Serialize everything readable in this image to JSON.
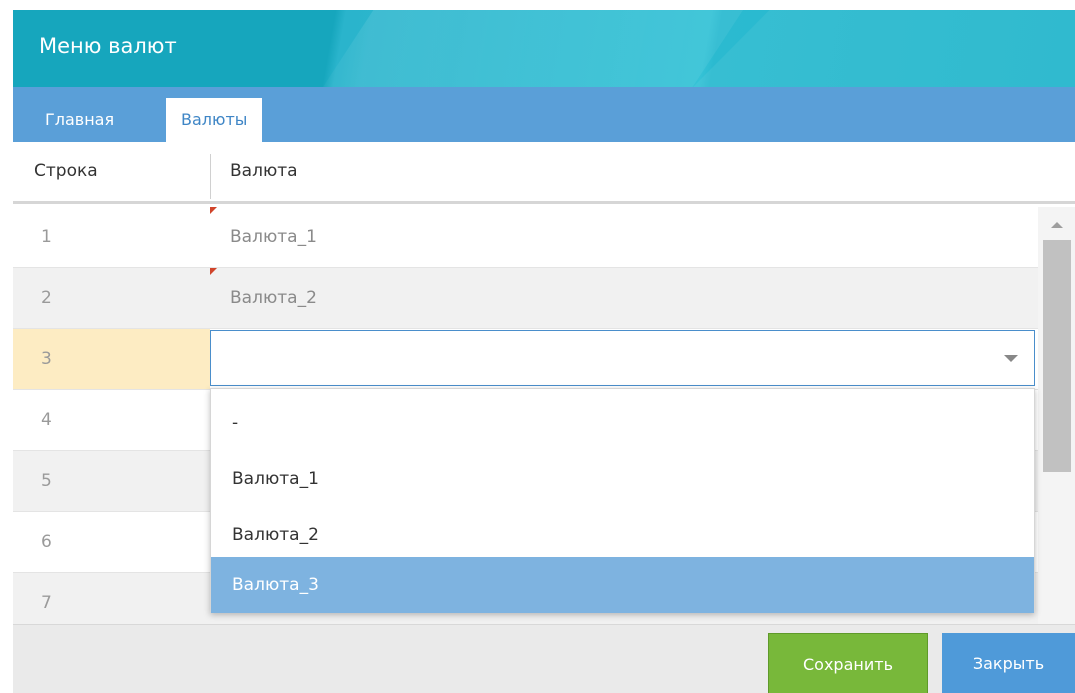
{
  "window": {
    "title": "Меню валют"
  },
  "tabs": [
    {
      "label": "Главная",
      "active": false
    },
    {
      "label": "Валюты",
      "active": true
    }
  ],
  "table": {
    "columns": [
      "Строка",
      "Валюта"
    ],
    "rows": [
      {
        "num": "1",
        "value": "Валюта_1",
        "flag": true
      },
      {
        "num": "2",
        "value": "Валюта_2",
        "flag": true
      },
      {
        "num": "3",
        "value": "",
        "editing": true
      },
      {
        "num": "4",
        "value": ""
      },
      {
        "num": "5",
        "value": ""
      },
      {
        "num": "6",
        "value": ""
      },
      {
        "num": "7",
        "value": ""
      }
    ]
  },
  "dropdown": {
    "options": [
      "-",
      "Валюта_1",
      "Валюта_2",
      "Валюта_3"
    ],
    "highlighted": "Валюта_3"
  },
  "footer": {
    "save_label": "Сохранить",
    "close_label": "Закрыть"
  },
  "colors": {
    "title_bar": "#16a6bd",
    "tab_bar": "#5a9fd8",
    "active_row_number": "#fdecc3",
    "highlight_option": "#7eb3e0",
    "save_button": "#78b83a",
    "close_button": "#4f9ad9",
    "modified_flag": "#d0442a"
  },
  "icons": {
    "dropdown_arrow": "chevron-down-icon",
    "scroll_up": "scroll-up-arrow-icon",
    "modified_marker": "modified-flag-icon"
  }
}
